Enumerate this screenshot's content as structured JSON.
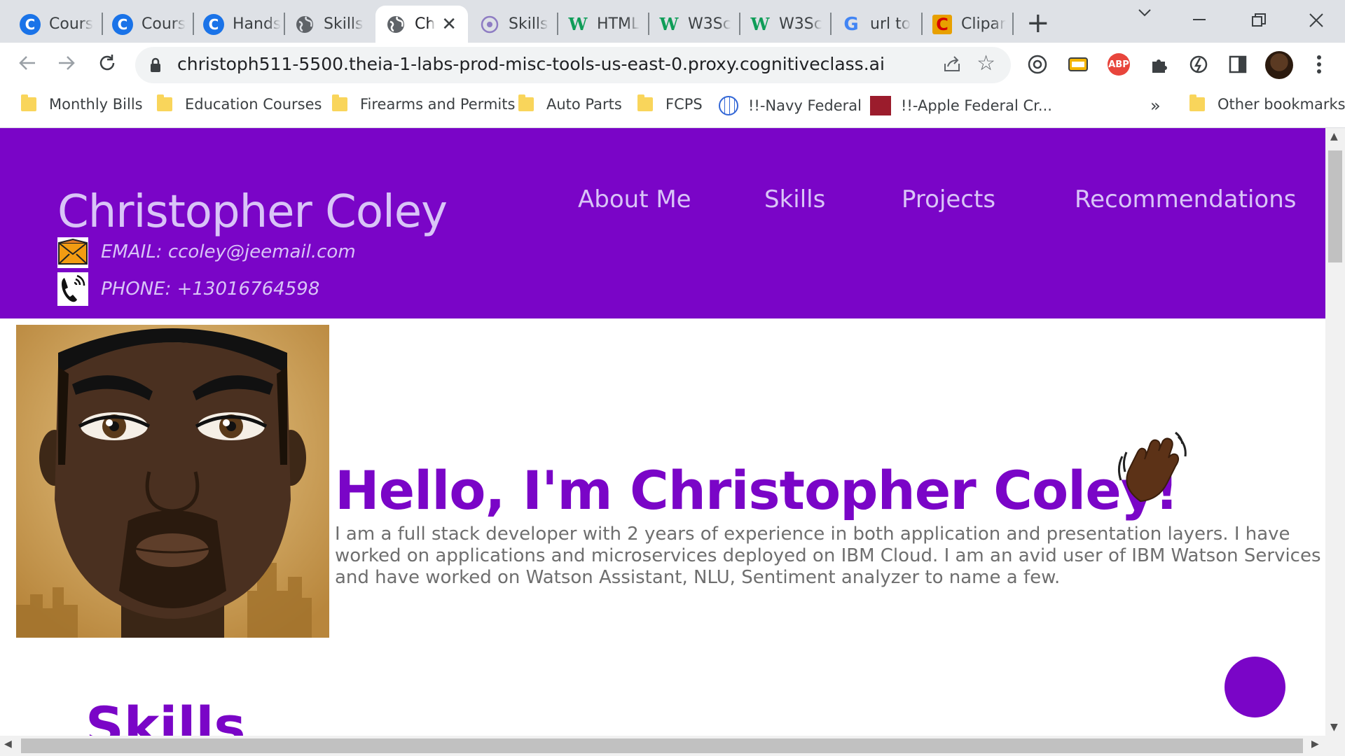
{
  "browser": {
    "tabs": [
      {
        "label": "Cours",
        "icon": "coursera-icon"
      },
      {
        "label": "Cours",
        "icon": "coursera-icon"
      },
      {
        "label": "Hands",
        "icon": "coursera-icon"
      },
      {
        "label": "Skills",
        "icon": "globe-icon"
      },
      {
        "label": "Ch",
        "icon": "globe-icon",
        "active": true
      },
      {
        "label": "Skills",
        "icon": "skills-network-icon"
      },
      {
        "label": "HTML",
        "icon": "w3schools-icon"
      },
      {
        "label": "W3Sc",
        "icon": "w3schools-icon"
      },
      {
        "label": "W3Sc",
        "icon": "w3schools-icon"
      },
      {
        "label": "url to",
        "icon": "google-icon"
      },
      {
        "label": "Clipar",
        "icon": "clipart-icon"
      }
    ],
    "url": "christoph511-5500.theia-1-labs-prod-misc-tools-us-east-0.proxy.cognitiveclass.ai",
    "bookmarks": [
      {
        "label": "Monthly Bills",
        "icon": "folder-icon"
      },
      {
        "label": "Education Courses",
        "icon": "folder-icon"
      },
      {
        "label": "Firearms and Permits",
        "icon": "folder-icon"
      },
      {
        "label": "Auto Parts",
        "icon": "folder-icon"
      },
      {
        "label": "FCPS",
        "icon": "folder-icon"
      },
      {
        "label": "!!-Navy Federal",
        "icon": "globe-icon"
      },
      {
        "label": "!!-Apple Federal Cr...",
        "icon": "apple-federal-icon"
      }
    ],
    "overflow_label": "»",
    "other_bookmarks": "Other bookmarks"
  },
  "site": {
    "name": "Christopher Coley",
    "email": "EMAIL: ccoley@jeemail.com",
    "phone": "PHONE: +13016764598",
    "nav": [
      "About Me",
      "Skills",
      "Projects",
      "Recommendations"
    ],
    "hello": "Hello, I'm Christopher Coley!",
    "intro": "I am a full stack developer with 2 years of experience in both application and presentation layers. I have worked on applications and microservices deployed on IBM Cloud. I am an avid user of IBM Watson Services and have worked on Watson Assistant, NLU, Sentiment analyzer to name a few.",
    "skills_heading": "Skills"
  },
  "colors": {
    "brand_purple": "#7a05c7",
    "header_text": "#d9c4f7",
    "body_text": "#6e6e6e"
  }
}
